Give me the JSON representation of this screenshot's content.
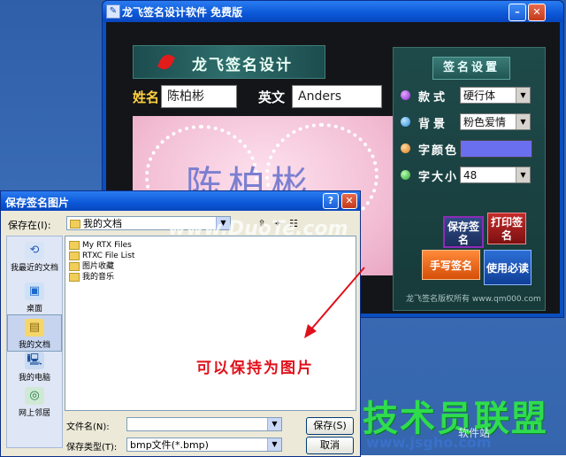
{
  "app": {
    "title": "龙飞签名设计软件 免费版",
    "banner": "龙飞签名设计",
    "name_label": "姓名",
    "name_value": "陈柏彬",
    "english_label": "英文",
    "english_value": "Anders",
    "preview_name": "陈柏彬",
    "settings": {
      "title": "签名设置",
      "style_label": "款式",
      "style_value": "硬行体",
      "bg_label": "背景",
      "bg_value": "粉色爱情",
      "color_label": "字颜色",
      "font_color": "#6a6ff0",
      "size_label": "字大小",
      "size_value": "48"
    },
    "buttons": {
      "save": "保存签名",
      "print": "打印签名",
      "handwrite": "手写签名",
      "must_read": "使用必读"
    },
    "copyright": "龙飞签名版权所有  www.qm000.com"
  },
  "dialog": {
    "title": "保存签名图片",
    "save_in_label": "保存在(I):",
    "save_in_value": "我的文档",
    "places": [
      "我最近的文档",
      "桌面",
      "我的文档",
      "我的电脑",
      "网上邻居"
    ],
    "selected_place": "我的文档",
    "files": [
      "My RTX Files",
      "RTXC File List",
      "图片收藏",
      "我的音乐"
    ],
    "filename_label": "文件名(N):",
    "filename_value": "",
    "filetype_label": "保存类型(T):",
    "filetype_value": "bmp文件(*.bmp)",
    "save_button": "保存(S)",
    "cancel_button": "取消"
  },
  "annotation": "可以保持为图片",
  "watermarks": {
    "center": "www.DuoTe.com",
    "brand": "技术员联盟",
    "url": "www.jsgho.com",
    "side": "软件站"
  }
}
